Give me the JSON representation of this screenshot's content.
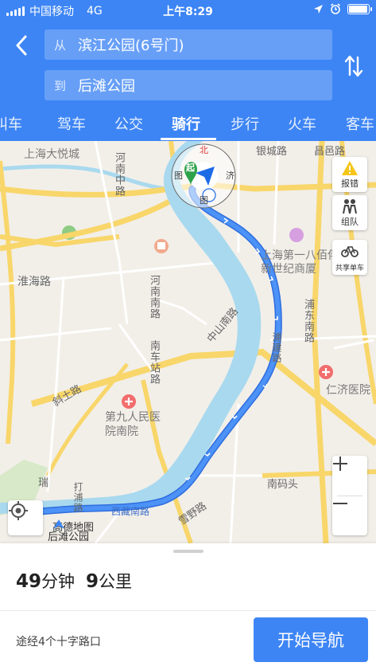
{
  "status_bar": {
    "carrier": "中国移动",
    "network": "4G",
    "time": "上午8:29",
    "battery_level": 0.95,
    "icons": [
      "signal-icon",
      "location-arrow-icon",
      "alarm-icon",
      "battery-icon"
    ]
  },
  "route_input": {
    "from_prefix": "从",
    "from_value": "滨江公园(6号门)",
    "to_prefix": "到",
    "to_value": "后滩公园",
    "back_icon": "chevron-left-icon",
    "swap_icon": "swap-vertical-icon"
  },
  "tabs": [
    {
      "label": "叫车",
      "active": false
    },
    {
      "label": "驾车",
      "active": false
    },
    {
      "label": "公交",
      "active": false
    },
    {
      "label": "骑行",
      "active": true
    },
    {
      "label": "步行",
      "active": false
    },
    {
      "label": "火车",
      "active": false
    },
    {
      "label": "客车",
      "active": false
    }
  ],
  "map": {
    "labels": {
      "shanghai_joy_city": "上海大悦城",
      "henan_mid_rd": "河南中路",
      "yincheng_rd": "银城路",
      "changyi_rd": "昌邑路",
      "huaihai_rd": "淮海路",
      "shanghai_no1_yaohan": "上海第一八佰伴",
      "new_century_plaza": "新世纪商厦",
      "henan_south_rd": "河南南路",
      "pudong_south_rd": "浦东南路",
      "zhongshan_south_rd": "中山南路",
      "nanche_station_rd": "南车站路",
      "pujian_rd": "浦建路",
      "renji_hospital": "仁济医院",
      "xietu_rd": "斜土路",
      "ninth_hospital": "第九人民医院南院",
      "nanmatou": "南码头",
      "rui": "瑞",
      "dapu_rd": "打浦路",
      "xipu_tunnel": "西藏南路",
      "xueye_rd": "雪野路",
      "houtan_park": "后滩公园",
      "compass_north": "北",
      "compass_west": "图",
      "compass_east": "济",
      "compass_south": "图",
      "start_marker": "起",
      "end_marker": "终"
    },
    "side_buttons": [
      {
        "label": "报错",
        "icon": "warning-icon"
      },
      {
        "label": "组队",
        "icon": "team-icon"
      },
      {
        "label": "共享单车",
        "icon": "bicycle-icon"
      }
    ],
    "zoom_in_label": "+",
    "zoom_out_label": "−",
    "brand": "高德地图",
    "colors": {
      "route": "#3d85f5",
      "river": "#a9d9ee",
      "road_yellow": "#f8d66a",
      "land": "#f2efe9"
    }
  },
  "summary": {
    "duration_num": "49",
    "duration_unit": "分钟",
    "distance_num": "9",
    "distance_unit": "公里",
    "via": "途经4个十字路口",
    "start_button": "开始导航"
  }
}
